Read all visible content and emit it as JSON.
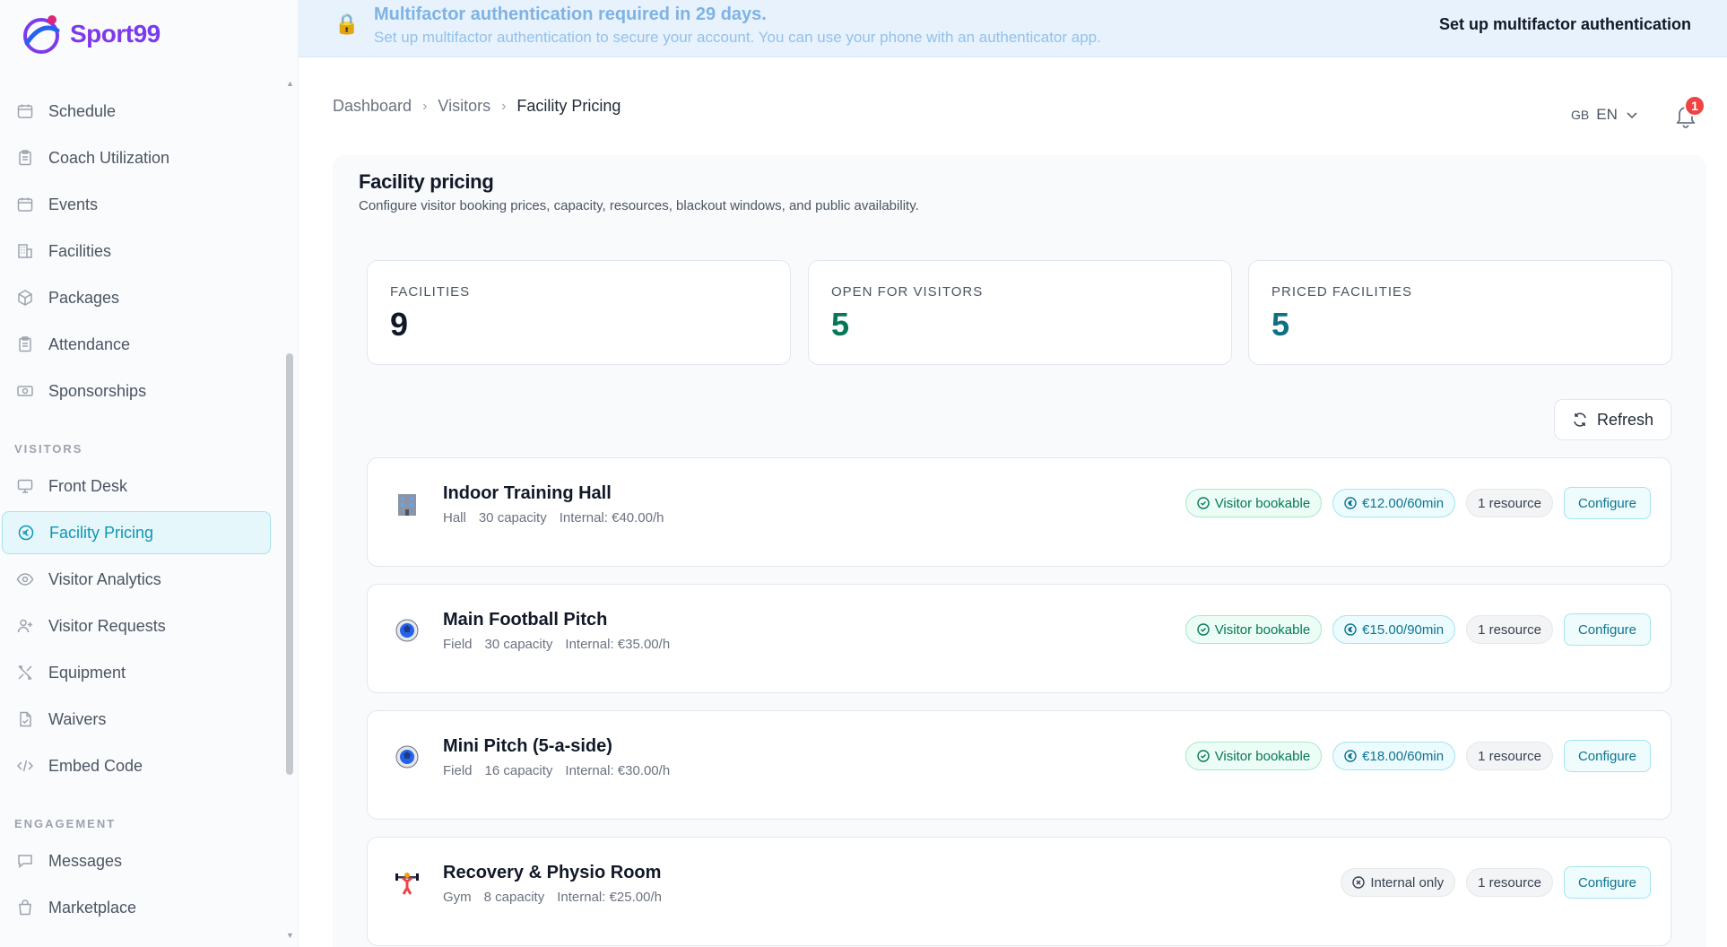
{
  "brand": {
    "name": "Sport99",
    "color": "#7c3aed"
  },
  "sidebar": {
    "items_top": [
      {
        "label": "Schedule",
        "icon": "calendar-icon"
      },
      {
        "label": "Coach Utilization",
        "icon": "clipboard-icon"
      },
      {
        "label": "Events",
        "icon": "calendar-icon"
      },
      {
        "label": "Facilities",
        "icon": "building-icon"
      },
      {
        "label": "Packages",
        "icon": "package-icon"
      },
      {
        "label": "Attendance",
        "icon": "clipboard-icon"
      },
      {
        "label": "Sponsorships",
        "icon": "banknote-icon"
      }
    ],
    "section_visitors": "VISITORS",
    "items_visitors": [
      {
        "label": "Front Desk",
        "icon": "monitor-icon"
      },
      {
        "label": "Facility Pricing",
        "icon": "euro-icon",
        "active": true
      },
      {
        "label": "Visitor Analytics",
        "icon": "eye-icon"
      },
      {
        "label": "Visitor Requests",
        "icon": "user-plus-icon"
      },
      {
        "label": "Equipment",
        "icon": "tools-icon"
      },
      {
        "label": "Waivers",
        "icon": "file-check-icon"
      },
      {
        "label": "Embed Code",
        "icon": "code-icon"
      }
    ],
    "section_engagement": "ENGAGEMENT",
    "items_engagement": [
      {
        "label": "Messages",
        "icon": "message-icon"
      },
      {
        "label": "Marketplace",
        "icon": "shopping-bag-icon"
      }
    ]
  },
  "banner": {
    "title": "Multifactor authentication required in 29 days.",
    "subtitle": "Set up multifactor authentication to secure your account. You can use your phone with an authenticator app.",
    "action": "Set up multifactor authentication"
  },
  "breadcrumb": {
    "items": [
      "Dashboard",
      "Visitors"
    ],
    "current": "Facility Pricing"
  },
  "header": {
    "flag": "GB",
    "language": "EN",
    "notifications": "1"
  },
  "page": {
    "title": "Facility pricing",
    "subtitle": "Configure visitor booking prices, capacity, resources, blackout windows, and public availability."
  },
  "stats": [
    {
      "label": "FACILITIES",
      "value": "9",
      "color": "#111827"
    },
    {
      "label": "OPEN FOR VISITORS",
      "value": "5",
      "color": "#047857"
    },
    {
      "label": "PRICED FACILITIES",
      "value": "5",
      "color": "#0e6f85"
    }
  ],
  "refresh_label": "Refresh",
  "facilities": [
    {
      "name": "Indoor Training Hall",
      "type": "Hall",
      "capacity": "30 capacity",
      "internal": "Internal: €40.00/h",
      "icon": "building-icon",
      "status": "Visitor bookable",
      "price": "€12.00/60min",
      "resources": "1 resource",
      "configure": "Configure"
    },
    {
      "name": "Main Football Pitch",
      "type": "Field",
      "capacity": "30 capacity",
      "internal": "Internal: €35.00/h",
      "icon": "soccer-ball-icon",
      "status": "Visitor bookable",
      "price": "€15.00/90min",
      "resources": "1 resource",
      "configure": "Configure"
    },
    {
      "name": "Mini Pitch (5-a-side)",
      "type": "Field",
      "capacity": "16 capacity",
      "internal": "Internal: €30.00/h",
      "icon": "soccer-ball-icon",
      "status": "Visitor bookable",
      "price": "€18.00/60min",
      "resources": "1 resource",
      "configure": "Configure"
    },
    {
      "name": "Recovery & Physio Room",
      "type": "Gym",
      "capacity": "8 capacity",
      "internal": "Internal: €25.00/h",
      "icon": "weightlifter-icon",
      "status": "Internal only",
      "price": "",
      "resources": "1 resource",
      "configure": "Configure"
    }
  ]
}
